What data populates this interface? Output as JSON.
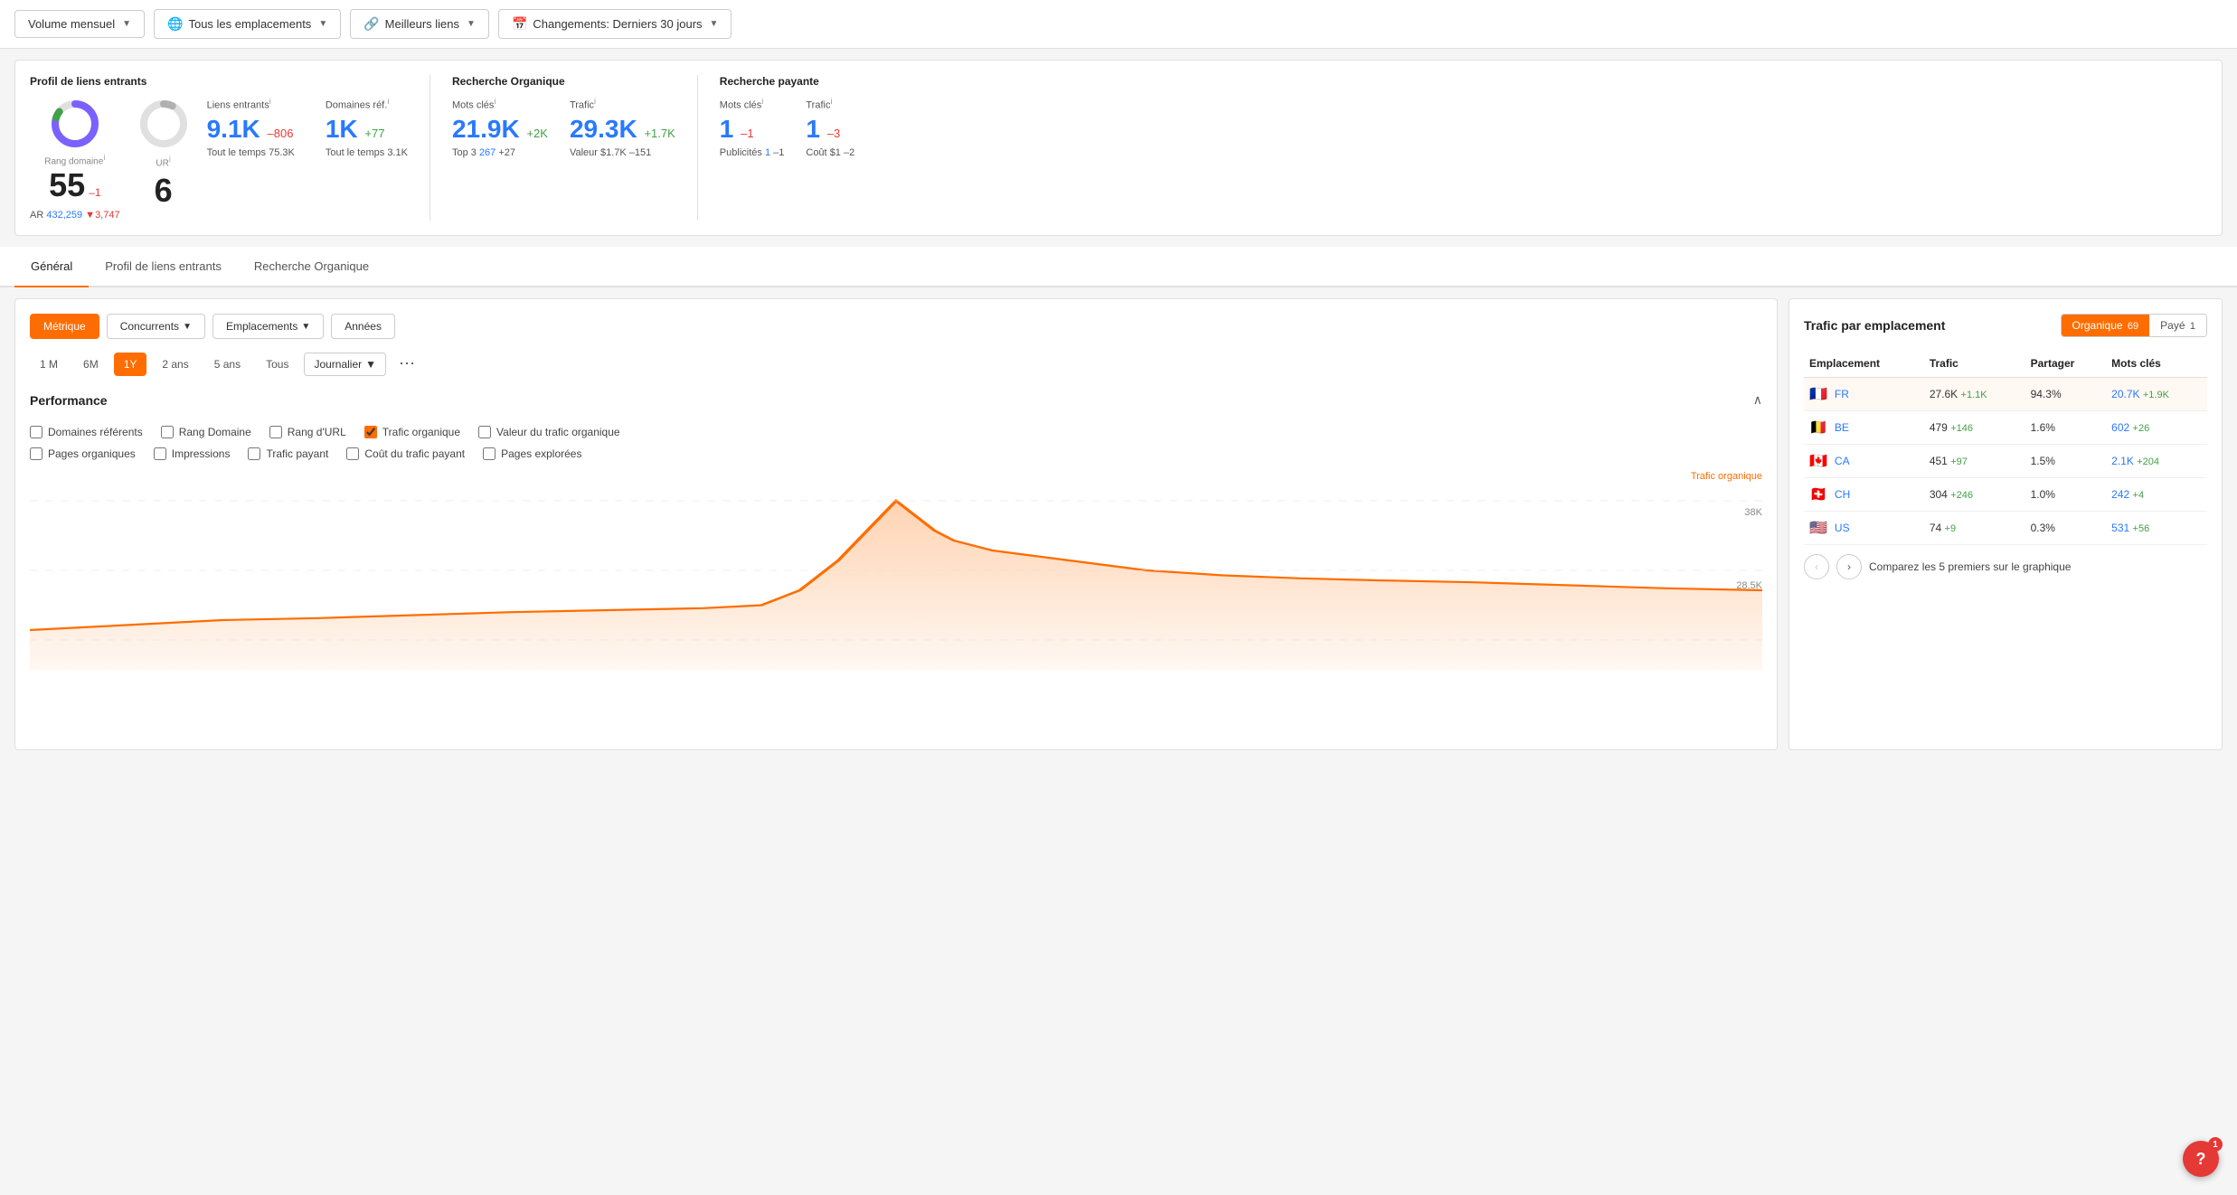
{
  "toolbar": {
    "btn1": "Volume mensuel",
    "btn2": "Tous les emplacements",
    "btn3": "Meilleurs liens",
    "btn4": "Changements: Derniers 30 jours"
  },
  "summary": {
    "backlinks_title": "Profil de liens entrants",
    "rang_domaine_label": "Rang domaine",
    "rang_domaine_value": "55",
    "rang_domaine_change": "–1",
    "ar_label": "AR",
    "ar_value": "432,259",
    "ar_change": "3,747",
    "ur_label": "UR",
    "ur_info": "i",
    "ur_value": "6",
    "liens_entrants_label": "Liens entrants",
    "liens_entrants_value": "9.1K",
    "liens_entrants_change": "–806",
    "liens_entrants_sub": "Tout le temps",
    "liens_entrants_sub_val": "75.3K",
    "domaines_ref_label": "Domaines réf.",
    "domaines_ref_value": "1K",
    "domaines_ref_change": "+77",
    "domaines_ref_sub": "Tout le temps",
    "domaines_ref_sub_val": "3.1K",
    "organic_title": "Recherche Organique",
    "mots_cles_label": "Mots clés",
    "mots_cles_value": "21.9K",
    "mots_cles_change": "+2K",
    "trafic_label": "Trafic",
    "trafic_value": "29.3K",
    "trafic_change": "+1.7K",
    "top3_label": "Top 3",
    "top3_value": "267",
    "top3_change": "+27",
    "valeur_label": "Valeur",
    "valeur_value": "$1.7K",
    "valeur_change": "–151",
    "paid_title": "Recherche payante",
    "paid_mots_cles_label": "Mots clés",
    "paid_mots_cles_value": "1",
    "paid_mots_cles_change": "–1",
    "paid_trafic_label": "Trafic",
    "paid_trafic_value": "1",
    "paid_trafic_change": "–3",
    "paid_pub_label": "Publicités",
    "paid_pub_value": "1",
    "paid_pub_change": "–1",
    "paid_cout_label": "Coût",
    "paid_cout_value": "$1",
    "paid_cout_change": "–2"
  },
  "tabs": {
    "items": [
      "Général",
      "Profil de liens entrants",
      "Recherche Organique"
    ],
    "active": 0
  },
  "chart_panel": {
    "ctrl_btn1": "Métrique",
    "ctrl_btn2": "Concurrents",
    "ctrl_btn3": "Emplacements",
    "ctrl_btn4": "Années",
    "periods": [
      "1 M",
      "6M",
      "1Y",
      "2 ans",
      "5 ans",
      "Tous"
    ],
    "active_period": 2,
    "granularity": "Journalier",
    "performance_title": "Performance",
    "checkboxes": [
      {
        "label": "Domaines référents",
        "checked": false
      },
      {
        "label": "Rang Domaine",
        "checked": false
      },
      {
        "label": "Rang d'URL",
        "checked": false
      },
      {
        "label": "Trafic organique",
        "checked": true
      },
      {
        "label": "Valeur du trafic organique",
        "checked": false
      },
      {
        "label": "Pages organiques",
        "checked": false
      },
      {
        "label": "Impressions",
        "checked": false
      },
      {
        "label": "Trafic payant",
        "checked": false
      },
      {
        "label": "Coût du trafic payant",
        "checked": false
      },
      {
        "label": "Pages explorées",
        "checked": false
      }
    ],
    "chart_series_label": "Trafic organique",
    "y_label1": "38K",
    "y_label2": "28.5K"
  },
  "right_panel": {
    "title": "Trafic par emplacement",
    "tab_organic": "Organique",
    "tab_organic_count": "69",
    "tab_paid": "Payé",
    "tab_paid_count": "1",
    "active_tab": "organic",
    "columns": [
      "Emplacement",
      "Trafic",
      "Partager",
      "Mots clés"
    ],
    "rows": [
      {
        "flag": "🇫🇷",
        "code": "FR",
        "trafic": "27.6K",
        "trafic_change": "+1.1K",
        "partager": "94.3%",
        "mots_cles": "20.7K",
        "mots_cles_change": "+1.9K",
        "highlight": true
      },
      {
        "flag": "🇧🇪",
        "code": "BE",
        "trafic": "479",
        "trafic_change": "+146",
        "partager": "1.6%",
        "mots_cles": "602",
        "mots_cles_change": "+26",
        "highlight": false
      },
      {
        "flag": "🇨🇦",
        "code": "CA",
        "trafic": "451",
        "trafic_change": "+97",
        "partager": "1.5%",
        "mots_cles": "2.1K",
        "mots_cles_change": "+204",
        "highlight": false
      },
      {
        "flag": "🇨🇭",
        "code": "CH",
        "trafic": "304",
        "trafic_change": "+246",
        "partager": "1.0%",
        "mots_cles": "242",
        "mots_cles_change": "+4",
        "highlight": false
      },
      {
        "flag": "🇺🇸",
        "code": "US",
        "trafic": "74",
        "trafic_change": "+9",
        "partager": "0.3%",
        "mots_cles": "531",
        "mots_cles_change": "+56",
        "highlight": false
      }
    ],
    "footer_text": "Comparez les 5 premiers sur le graphique"
  },
  "help": {
    "label": "?",
    "badge": "1"
  }
}
